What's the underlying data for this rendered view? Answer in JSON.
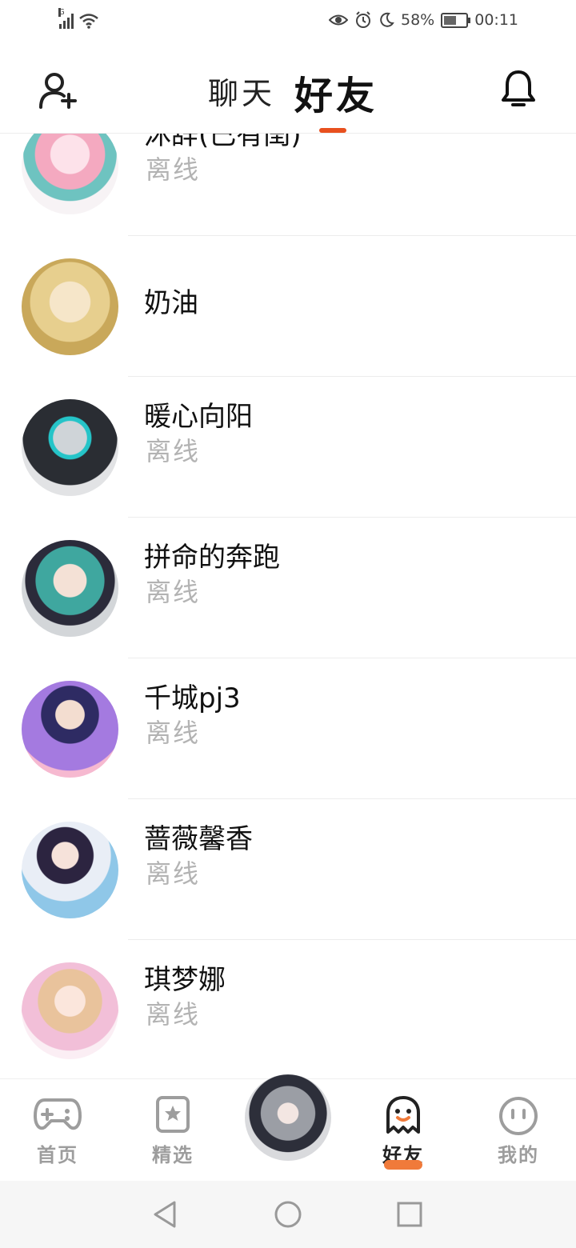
{
  "status_bar": {
    "signal_label": "G",
    "battery_percent": "58%",
    "time": "00:11",
    "battery_level": 0.58
  },
  "header": {
    "chat_tab": "聊天",
    "friends_tab": "好友",
    "active_tab": "friends"
  },
  "friends": [
    {
      "name": "沐辞(已有闺)",
      "status": "离线"
    },
    {
      "name": "奶油",
      "status": ""
    },
    {
      "name": "暖心向阳",
      "status": "离线"
    },
    {
      "name": "拼命的奔跑",
      "status": "离线"
    },
    {
      "name": "千城pj3",
      "status": "离线"
    },
    {
      "name": "蔷薇馨香",
      "status": "离线"
    },
    {
      "name": "琪梦娜",
      "status": "离线"
    }
  ],
  "bottom_nav": {
    "home": "首页",
    "featured": "精选",
    "friends": "好友",
    "mine": "我的",
    "active": "friends",
    "accent_color": "#f07a3a"
  },
  "icons": [
    "add-friend-icon",
    "bell-icon",
    "gamepad-icon",
    "star-icon",
    "ghost-icon",
    "smiley-icon",
    "back-icon",
    "home-icon",
    "recents-icon"
  ],
  "colors": {
    "tab_indicator": "#e8501e",
    "offline_text": "#b3b3b3"
  }
}
